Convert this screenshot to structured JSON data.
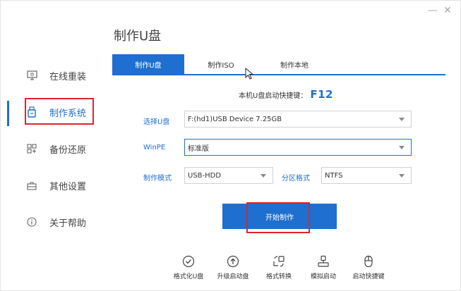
{
  "window": {
    "minimize_label": "—",
    "close_label": "✕"
  },
  "header": {
    "title": "制作U盘"
  },
  "sidebar": {
    "items": [
      {
        "label": "在线重装",
        "icon": "monitor-icon"
      },
      {
        "label": "制作系统",
        "icon": "usb-drive-icon",
        "active": true
      },
      {
        "label": "备份还原",
        "icon": "grid-backup-icon"
      },
      {
        "label": "其他设置",
        "icon": "toolbox-icon"
      },
      {
        "label": "关于帮助",
        "icon": "info-icon"
      }
    ]
  },
  "tabs": [
    {
      "label": "制作U盘",
      "active": true
    },
    {
      "label": "制作ISO"
    },
    {
      "label": "制作本地"
    }
  ],
  "shortcut": {
    "label": "本机U盘启动快捷键：",
    "key": "F12"
  },
  "form": {
    "usb_label": "选择U盘",
    "usb_value": "F:(hd1)USB Device 7.25GB",
    "winpe_label": "WinPE",
    "winpe_value": "标准版",
    "mode_label": "制作模式",
    "mode_value": "USB-HDD",
    "partition_label": "分区格式",
    "partition_value": "NTFS"
  },
  "start_button": {
    "label": "开始制作"
  },
  "tools": [
    {
      "label": "格式化U盘",
      "icon": "check-circle-icon"
    },
    {
      "label": "升级启动盘",
      "icon": "upload-circle-icon"
    },
    {
      "label": "格式转换",
      "icon": "convert-icon"
    },
    {
      "label": "模拟启动",
      "icon": "simulate-icon"
    },
    {
      "label": "启动快捷键",
      "icon": "mouse-icon"
    }
  ],
  "colors": {
    "accent": "#1e6fcf",
    "highlight": "#e0232b"
  }
}
